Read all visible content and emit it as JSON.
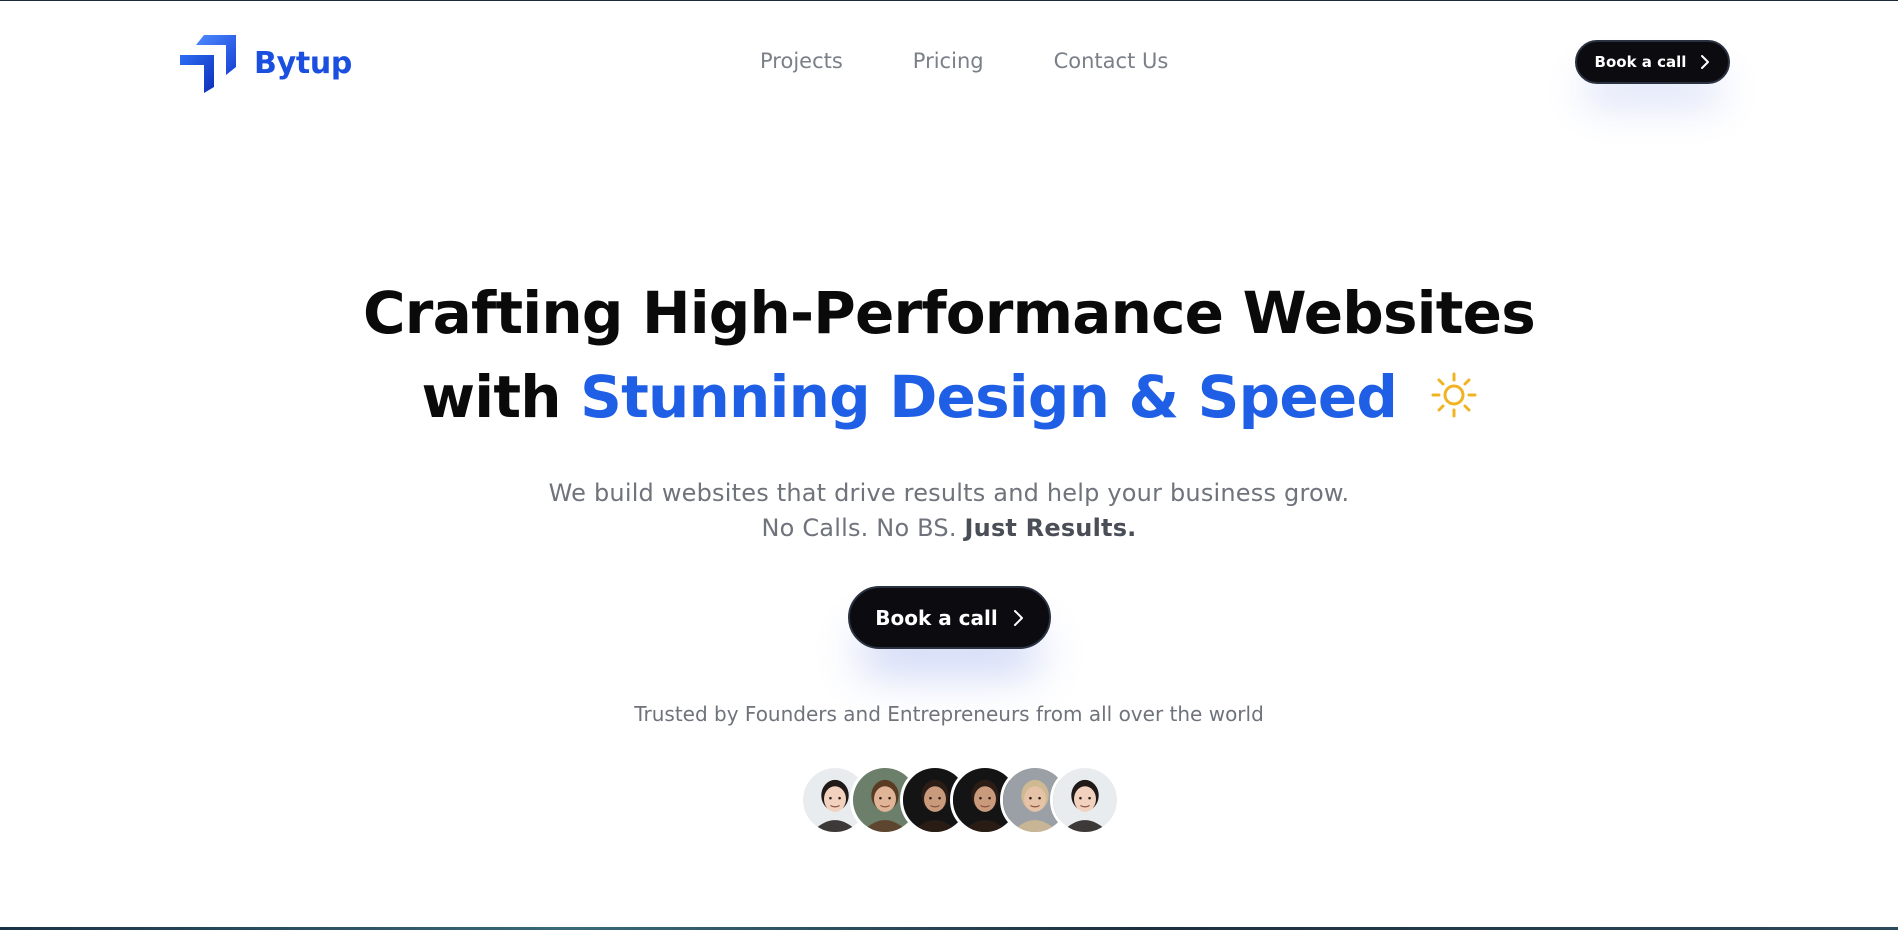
{
  "brand": {
    "name": "Bytup",
    "accent_color": "#1b4fe0"
  },
  "nav": {
    "links": [
      "Projects",
      "Pricing",
      "Contact Us"
    ],
    "cta_label": "Book a call"
  },
  "hero": {
    "title_line1": "Crafting High-Performance Websites",
    "title_line2_prefix": "with",
    "title_line2_accent": "Stunning Design & Speed",
    "emoji_icon": "sun-icon",
    "subtitle_line1": "We build websites that drive results and help your business grow.",
    "subtitle_line2_plain": "No Calls. No BS.",
    "subtitle_line2_bold": "Just Results.",
    "cta_label": "Book a call",
    "trusted_text": "Trusted by Founders and Entrepreneurs from all over the world"
  },
  "avatars": [
    {
      "name": "avatar-1",
      "bg": "#e9ecef",
      "skin": "#f2d2bf",
      "hair": "#1f1a18"
    },
    {
      "name": "avatar-2",
      "bg": "#6b7f6a",
      "skin": "#e0b597",
      "hair": "#5a3b24"
    },
    {
      "name": "avatar-3",
      "bg": "#141414",
      "skin": "#c99a7c",
      "hair": "#2b1d15"
    },
    {
      "name": "avatar-4",
      "bg": "#141414",
      "skin": "#c99a7c",
      "hair": "#2b1d15"
    },
    {
      "name": "avatar-5",
      "bg": "#9aa0a6",
      "skin": "#e6c2a6",
      "hair": "#cfb993"
    },
    {
      "name": "avatar-6",
      "bg": "#e9ecef",
      "skin": "#f2d2bf",
      "hair": "#1f1a18"
    }
  ],
  "colors": {
    "accent": "#1f5fe6",
    "button_bg": "#0b0b10",
    "muted_text": "#6f737b",
    "sun": "#f0b423"
  }
}
